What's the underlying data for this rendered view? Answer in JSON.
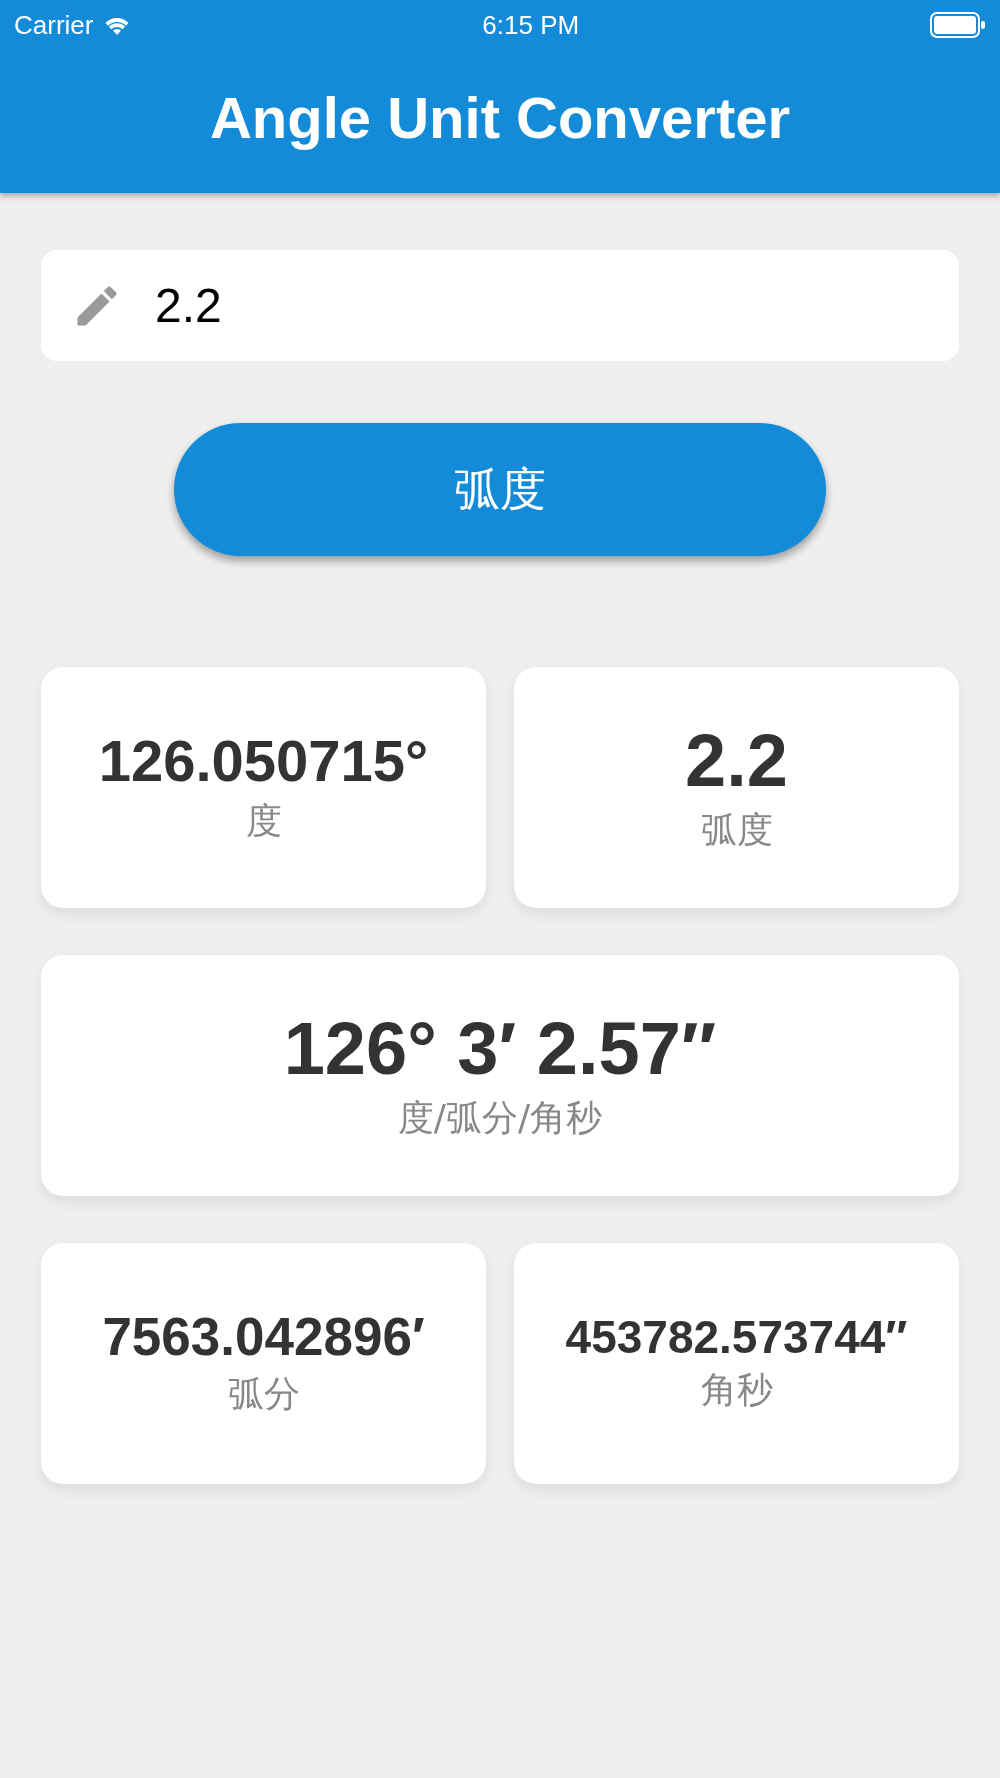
{
  "status_bar": {
    "carrier": "Carrier",
    "time": "6:15 PM"
  },
  "header": {
    "title": "Angle Unit Converter"
  },
  "input": {
    "value": "2.2"
  },
  "unit_button": {
    "label": "弧度"
  },
  "results": [
    [
      {
        "value": "126.050715°",
        "unit": "度"
      },
      {
        "value": "2.2",
        "unit": "弧度"
      }
    ],
    [
      {
        "value": "126° 3′ 2.57″",
        "unit": "度/弧分/角秒"
      }
    ],
    [
      {
        "value": "7563.042896′",
        "unit": "弧分"
      },
      {
        "value": "453782.573744″",
        "unit": "角秒"
      }
    ]
  ]
}
